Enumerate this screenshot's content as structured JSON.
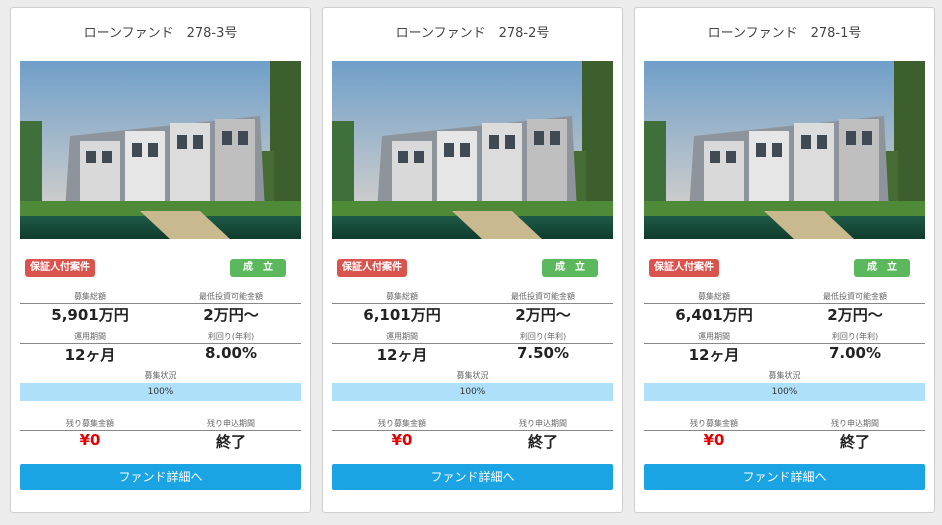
{
  "colors": {
    "guarantee_badge": "#d9534f",
    "status_badge": "#5cb85c",
    "progress": "#aee1f9",
    "button": "#1ba4e4",
    "remaining_amount": "#e00000"
  },
  "cards": [
    {
      "title": "ローンファンド　278-3号",
      "guarantee_badge": "保証人付案件",
      "status_badge": "成　立",
      "total_label": "募集総額",
      "total_value": "5,901万円",
      "min_label": "最低投資可能金額",
      "min_value": "2万円〜",
      "period_label": "運用期間",
      "period_value": "12ヶ月",
      "yield_label": "利回り(年利)",
      "yield_value": "8.00%",
      "status_label": "募集状況",
      "progress_text": "100%",
      "progress_fraction": 1.0,
      "remaining_label": "残り募集金額",
      "remaining_value": "¥0",
      "deadline_label": "残り申込期間",
      "deadline_value": "終了",
      "button_label": "ファンド詳細へ"
    },
    {
      "title": "ローンファンド　278-2号",
      "guarantee_badge": "保証人付案件",
      "status_badge": "成　立",
      "total_label": "募集総額",
      "total_value": "6,101万円",
      "min_label": "最低投資可能金額",
      "min_value": "2万円〜",
      "period_label": "運用期間",
      "period_value": "12ヶ月",
      "yield_label": "利回り(年利)",
      "yield_value": "7.50%",
      "status_label": "募集状況",
      "progress_text": "100%",
      "progress_fraction": 1.0,
      "remaining_label": "残り募集金額",
      "remaining_value": "¥0",
      "deadline_label": "残り申込期間",
      "deadline_value": "終了",
      "button_label": "ファンド詳細へ"
    },
    {
      "title": "ローンファンド　278-1号",
      "guarantee_badge": "保証人付案件",
      "status_badge": "成　立",
      "total_label": "募集総額",
      "total_value": "6,401万円",
      "min_label": "最低投資可能金額",
      "min_value": "2万円〜",
      "period_label": "運用期間",
      "period_value": "12ヶ月",
      "yield_label": "利回り(年利)",
      "yield_value": "7.00%",
      "status_label": "募集状況",
      "progress_text": "100%",
      "progress_fraction": 1.0,
      "remaining_label": "残り募集金額",
      "remaining_value": "¥0",
      "deadline_label": "残り申込期間",
      "deadline_value": "終了",
      "button_label": "ファンド詳細へ"
    }
  ]
}
